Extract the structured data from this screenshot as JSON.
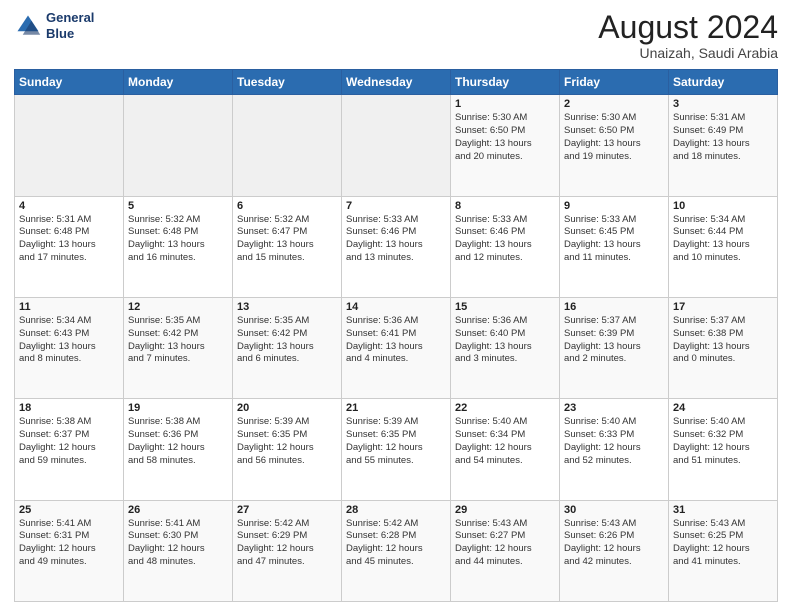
{
  "logo": {
    "line1": "General",
    "line2": "Blue"
  },
  "title": "August 2024",
  "subtitle": "Unaizah, Saudi Arabia",
  "headers": [
    "Sunday",
    "Monday",
    "Tuesday",
    "Wednesday",
    "Thursday",
    "Friday",
    "Saturday"
  ],
  "weeks": [
    [
      {
        "num": "",
        "info": ""
      },
      {
        "num": "",
        "info": ""
      },
      {
        "num": "",
        "info": ""
      },
      {
        "num": "",
        "info": ""
      },
      {
        "num": "1",
        "info": "Sunrise: 5:30 AM\nSunset: 6:50 PM\nDaylight: 13 hours\nand 20 minutes."
      },
      {
        "num": "2",
        "info": "Sunrise: 5:30 AM\nSunset: 6:50 PM\nDaylight: 13 hours\nand 19 minutes."
      },
      {
        "num": "3",
        "info": "Sunrise: 5:31 AM\nSunset: 6:49 PM\nDaylight: 13 hours\nand 18 minutes."
      }
    ],
    [
      {
        "num": "4",
        "info": "Sunrise: 5:31 AM\nSunset: 6:48 PM\nDaylight: 13 hours\nand 17 minutes."
      },
      {
        "num": "5",
        "info": "Sunrise: 5:32 AM\nSunset: 6:48 PM\nDaylight: 13 hours\nand 16 minutes."
      },
      {
        "num": "6",
        "info": "Sunrise: 5:32 AM\nSunset: 6:47 PM\nDaylight: 13 hours\nand 15 minutes."
      },
      {
        "num": "7",
        "info": "Sunrise: 5:33 AM\nSunset: 6:46 PM\nDaylight: 13 hours\nand 13 minutes."
      },
      {
        "num": "8",
        "info": "Sunrise: 5:33 AM\nSunset: 6:46 PM\nDaylight: 13 hours\nand 12 minutes."
      },
      {
        "num": "9",
        "info": "Sunrise: 5:33 AM\nSunset: 6:45 PM\nDaylight: 13 hours\nand 11 minutes."
      },
      {
        "num": "10",
        "info": "Sunrise: 5:34 AM\nSunset: 6:44 PM\nDaylight: 13 hours\nand 10 minutes."
      }
    ],
    [
      {
        "num": "11",
        "info": "Sunrise: 5:34 AM\nSunset: 6:43 PM\nDaylight: 13 hours\nand 8 minutes."
      },
      {
        "num": "12",
        "info": "Sunrise: 5:35 AM\nSunset: 6:42 PM\nDaylight: 13 hours\nand 7 minutes."
      },
      {
        "num": "13",
        "info": "Sunrise: 5:35 AM\nSunset: 6:42 PM\nDaylight: 13 hours\nand 6 minutes."
      },
      {
        "num": "14",
        "info": "Sunrise: 5:36 AM\nSunset: 6:41 PM\nDaylight: 13 hours\nand 4 minutes."
      },
      {
        "num": "15",
        "info": "Sunrise: 5:36 AM\nSunset: 6:40 PM\nDaylight: 13 hours\nand 3 minutes."
      },
      {
        "num": "16",
        "info": "Sunrise: 5:37 AM\nSunset: 6:39 PM\nDaylight: 13 hours\nand 2 minutes."
      },
      {
        "num": "17",
        "info": "Sunrise: 5:37 AM\nSunset: 6:38 PM\nDaylight: 13 hours\nand 0 minutes."
      }
    ],
    [
      {
        "num": "18",
        "info": "Sunrise: 5:38 AM\nSunset: 6:37 PM\nDaylight: 12 hours\nand 59 minutes."
      },
      {
        "num": "19",
        "info": "Sunrise: 5:38 AM\nSunset: 6:36 PM\nDaylight: 12 hours\nand 58 minutes."
      },
      {
        "num": "20",
        "info": "Sunrise: 5:39 AM\nSunset: 6:35 PM\nDaylight: 12 hours\nand 56 minutes."
      },
      {
        "num": "21",
        "info": "Sunrise: 5:39 AM\nSunset: 6:35 PM\nDaylight: 12 hours\nand 55 minutes."
      },
      {
        "num": "22",
        "info": "Sunrise: 5:40 AM\nSunset: 6:34 PM\nDaylight: 12 hours\nand 54 minutes."
      },
      {
        "num": "23",
        "info": "Sunrise: 5:40 AM\nSunset: 6:33 PM\nDaylight: 12 hours\nand 52 minutes."
      },
      {
        "num": "24",
        "info": "Sunrise: 5:40 AM\nSunset: 6:32 PM\nDaylight: 12 hours\nand 51 minutes."
      }
    ],
    [
      {
        "num": "25",
        "info": "Sunrise: 5:41 AM\nSunset: 6:31 PM\nDaylight: 12 hours\nand 49 minutes."
      },
      {
        "num": "26",
        "info": "Sunrise: 5:41 AM\nSunset: 6:30 PM\nDaylight: 12 hours\nand 48 minutes."
      },
      {
        "num": "27",
        "info": "Sunrise: 5:42 AM\nSunset: 6:29 PM\nDaylight: 12 hours\nand 47 minutes."
      },
      {
        "num": "28",
        "info": "Sunrise: 5:42 AM\nSunset: 6:28 PM\nDaylight: 12 hours\nand 45 minutes."
      },
      {
        "num": "29",
        "info": "Sunrise: 5:43 AM\nSunset: 6:27 PM\nDaylight: 12 hours\nand 44 minutes."
      },
      {
        "num": "30",
        "info": "Sunrise: 5:43 AM\nSunset: 6:26 PM\nDaylight: 12 hours\nand 42 minutes."
      },
      {
        "num": "31",
        "info": "Sunrise: 5:43 AM\nSunset: 6:25 PM\nDaylight: 12 hours\nand 41 minutes."
      }
    ]
  ]
}
